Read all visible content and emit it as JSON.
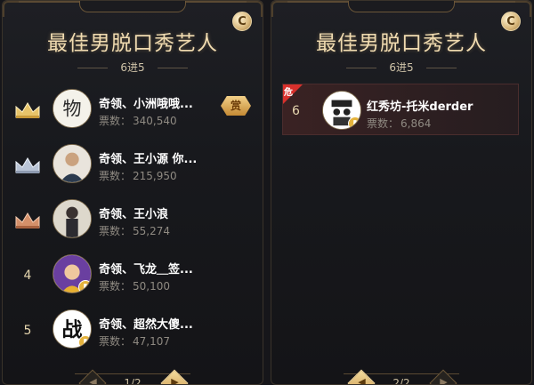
{
  "colors": {
    "gold": "#f0dbb0",
    "panel_bg": "#1e1f24",
    "danger": "#d8302c",
    "reward": "#e3b25f"
  },
  "left_panel": {
    "title": "最佳男脱口秀艺人",
    "round": "6进5",
    "badge": "C",
    "pager": {
      "text": "1/2"
    },
    "rows": [
      {
        "rank": "1",
        "rank_icon": "gold-crown-icon",
        "name": "奇领、小洲哦哦...",
        "votes_label": "票数：",
        "votes": "340,540",
        "reward": "赏",
        "avatar_glyph": "物"
      },
      {
        "rank": "2",
        "rank_icon": "silver-crown-icon",
        "name": "奇领、王小源 你...",
        "votes_label": "票数：",
        "votes": "215,950",
        "avatar_glyph": ""
      },
      {
        "rank": "3",
        "rank_icon": "bronze-crown-icon",
        "name": "奇领、王小浪",
        "votes_label": "票数：",
        "votes": "55,274",
        "avatar_glyph": ""
      },
      {
        "rank": "4",
        "name": "奇领、飞龙＿签...",
        "votes_label": "票数：",
        "votes": "50,100",
        "avatar_glyph": ""
      },
      {
        "rank": "5",
        "name": "奇领、超然大傻...",
        "votes_label": "票数：",
        "votes": "47,107",
        "avatar_glyph": "战"
      }
    ]
  },
  "right_panel": {
    "title": "最佳男脱口秀艺人",
    "round": "6进5",
    "badge": "C",
    "pager": {
      "text": "2/2"
    },
    "row": {
      "rank": "6",
      "danger": "危",
      "name": "红秀坊-托米derder",
      "votes_label": "票数：",
      "votes": "6,864"
    }
  }
}
